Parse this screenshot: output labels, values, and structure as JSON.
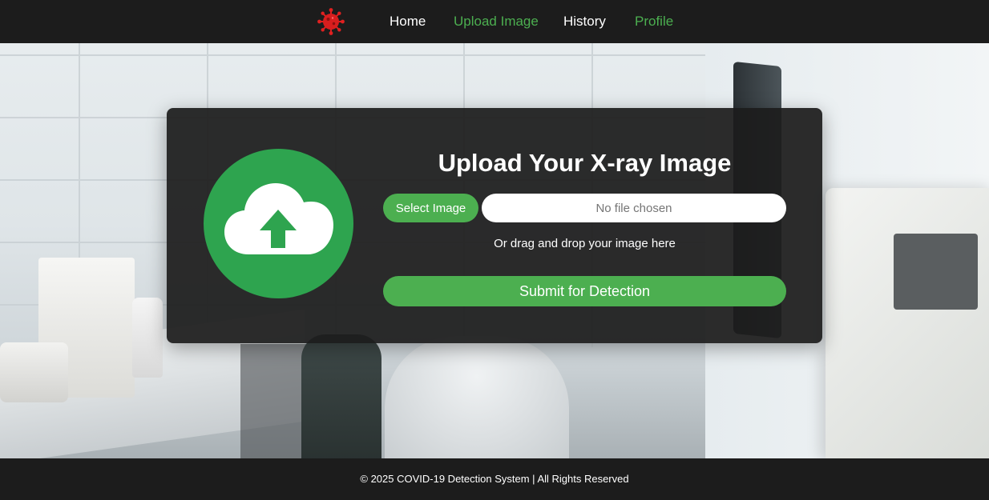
{
  "colors": {
    "nav_bg": "#1c1c1c",
    "accent_green": "#4caf50",
    "circle_green": "#2ea44f",
    "nav_active": "#4caf50",
    "nav_default": "#ffffff",
    "card_bg": "#1c1c1c",
    "logo_red": "#e02020"
  },
  "nav": {
    "logo_icon": "virus-icon",
    "items": [
      {
        "label": "Home",
        "color": "#ffffff"
      },
      {
        "label": "Upload Image",
        "color": "#4caf50"
      },
      {
        "label": "History",
        "color": "#ffffff"
      },
      {
        "label": "Profile",
        "color": "#4caf50"
      }
    ]
  },
  "upload": {
    "icon": "cloud-upload-icon",
    "title": "Upload Your X-ray Image",
    "select_label": "Select Image",
    "file_placeholder": "No file chosen",
    "drag_hint": "Or drag and drop your image here",
    "submit_label": "Submit for Detection"
  },
  "footer": {
    "text": "© 2025 COVID-19 Detection System | All Rights Reserved"
  }
}
